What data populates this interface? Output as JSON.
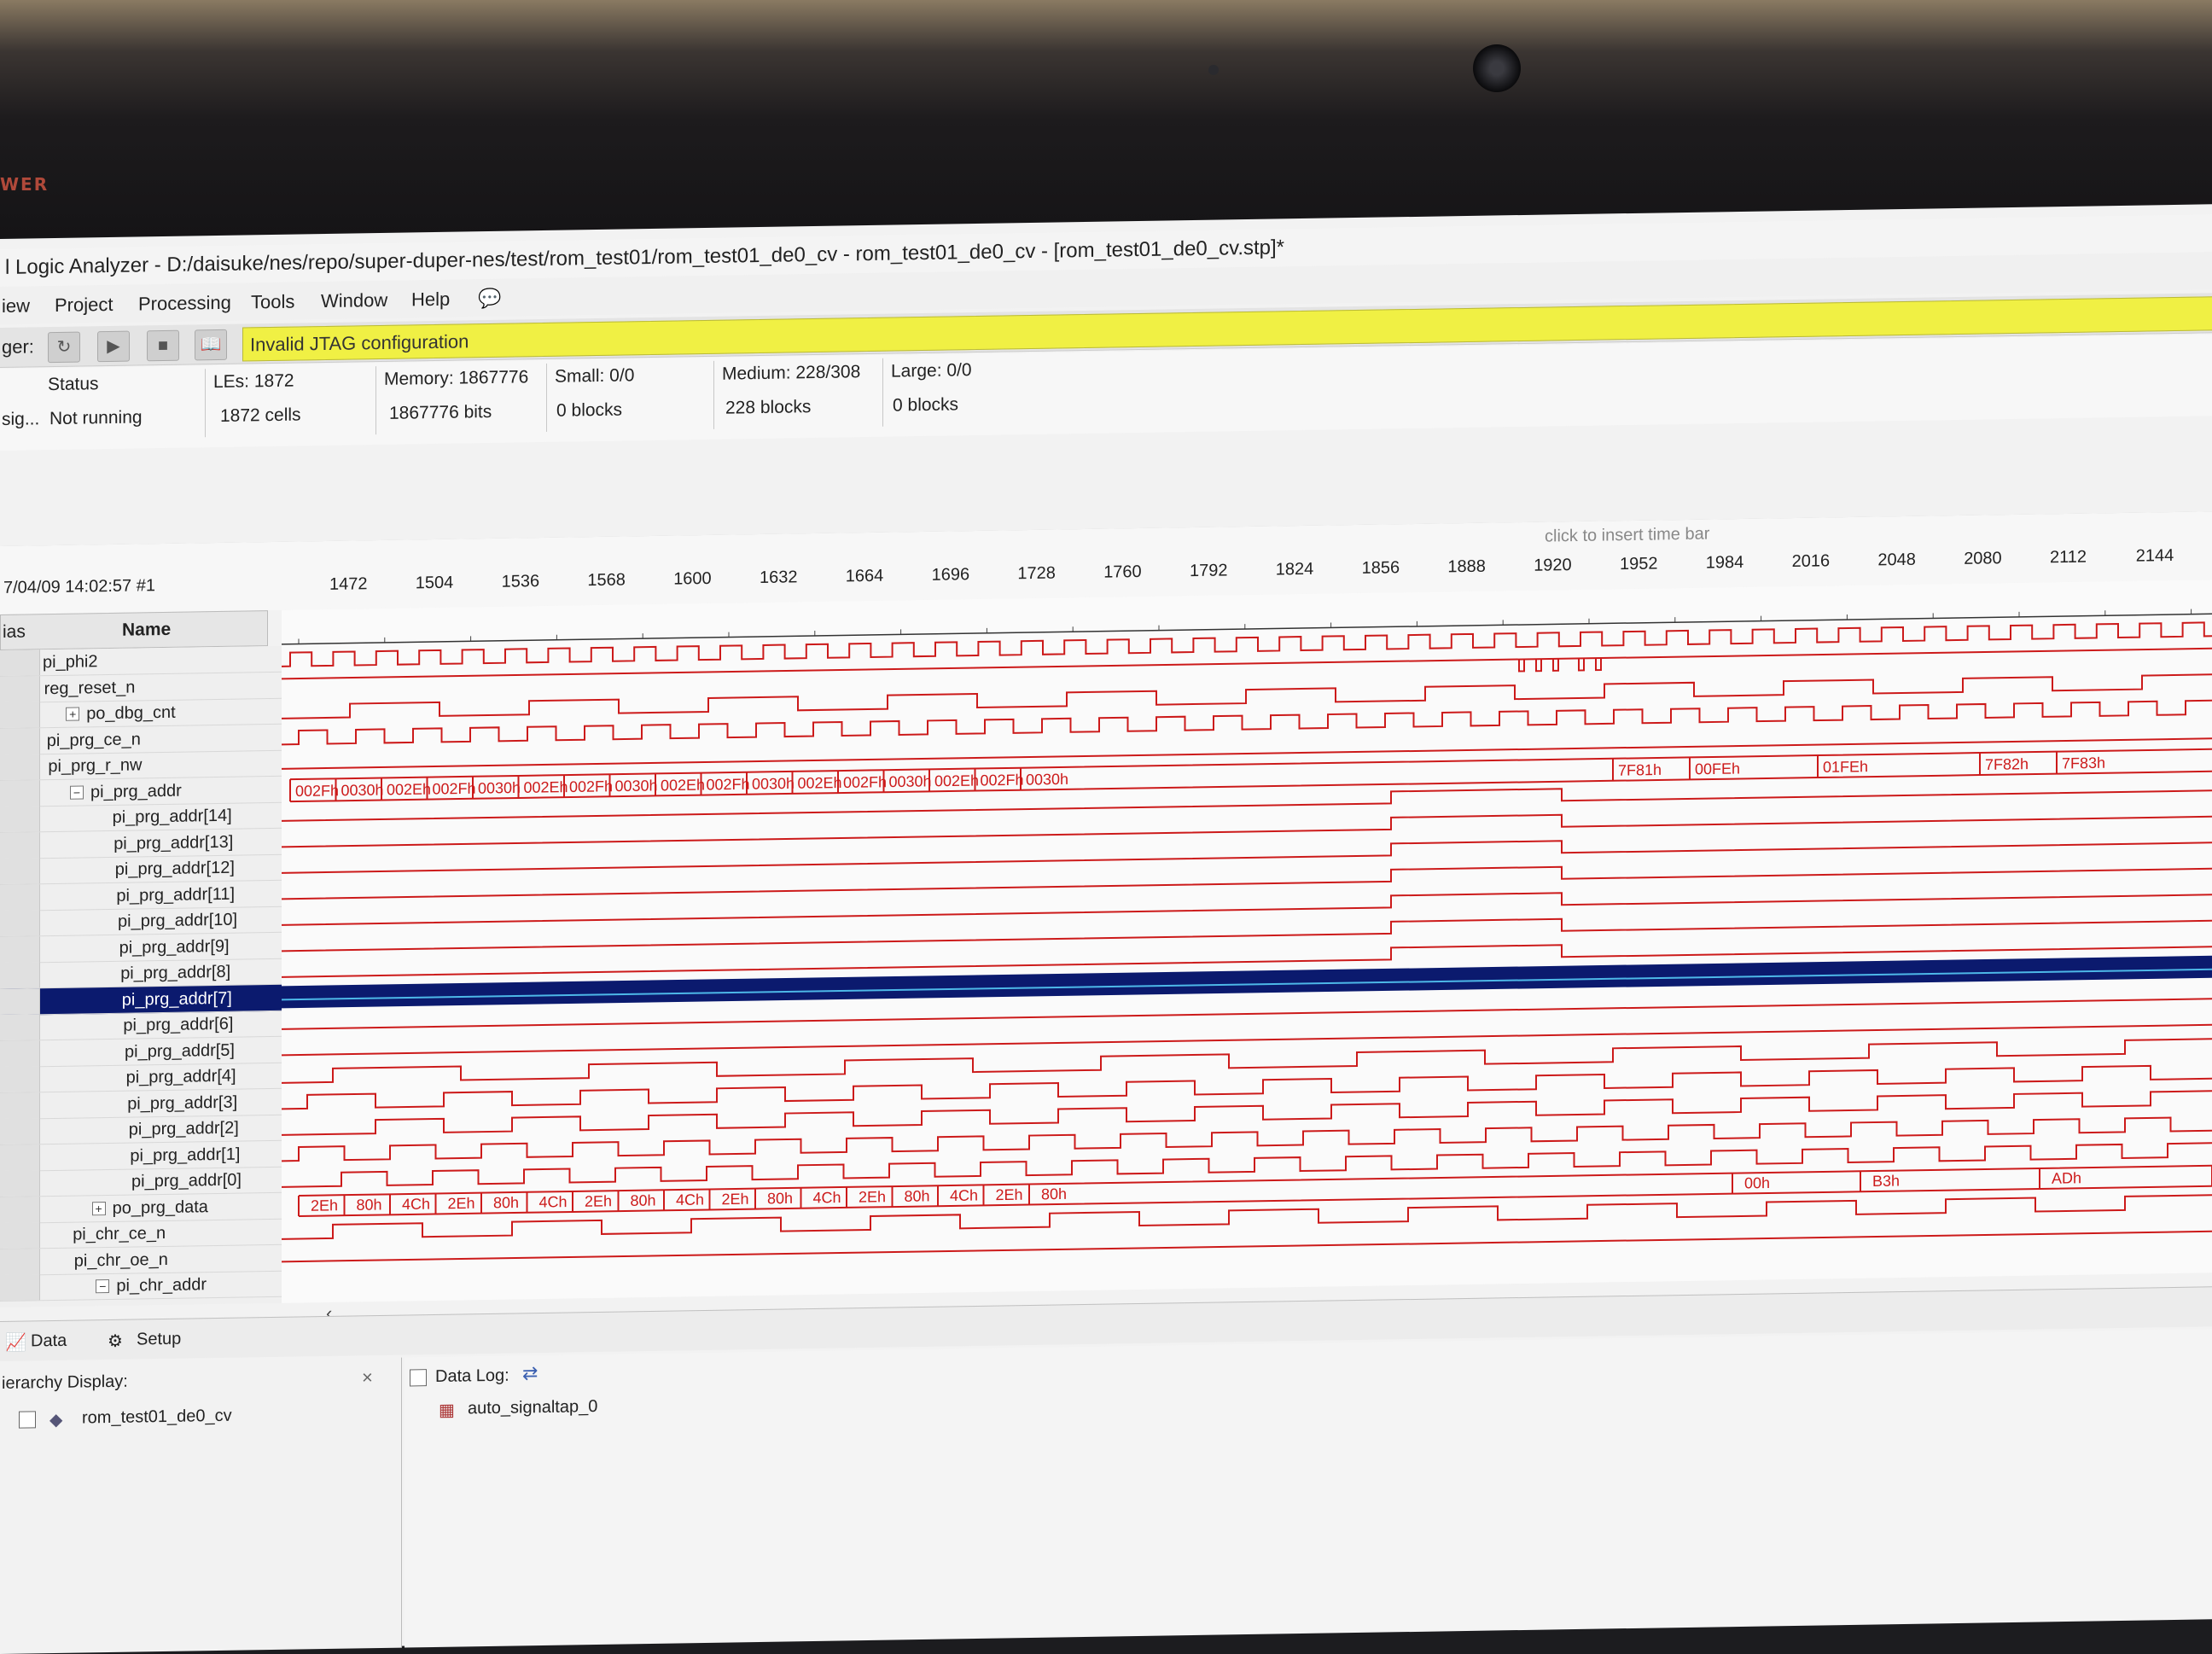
{
  "device_bezel": {
    "power_label": "WER"
  },
  "app": {
    "title": "l Logic Analyzer - D:/daisuke/nes/repo/super-duper-nes/test/rom_test01/rom_test01_de0_cv - rom_test01_de0_cv - [rom_test01_de0_cv.stp]*"
  },
  "menu": {
    "items": [
      "iew",
      "Project",
      "Processing",
      "Tools",
      "Window",
      "Help"
    ]
  },
  "toolbar": {
    "prefix_label": "ger:",
    "status_message": "Invalid JTAG configuration",
    "status_color": "#f0f044"
  },
  "status_table": {
    "headers": [
      "Status",
      "LEs: 1872",
      "Memory: 1867776",
      "Small: 0/0",
      "Medium: 228/308",
      "Large: 0/0"
    ],
    "row_label": "sig...",
    "values": [
      "Not running",
      "1872 cells",
      "1867776 bits",
      "0 blocks",
      "228 blocks",
      "0 blocks"
    ]
  },
  "timebar": {
    "insert_hint": "click to insert time bar",
    "timestamp": "7/04/09 14:02:57  #1",
    "ticks": [
      "1472",
      "1504",
      "1536",
      "1568",
      "1600",
      "1632",
      "1664",
      "1696",
      "1728",
      "1760",
      "1792",
      "1824",
      "1856",
      "1888",
      "1920",
      "1952",
      "1984",
      "2016",
      "2048",
      "2080",
      "2112",
      "2144",
      "2"
    ]
  },
  "signal_list": {
    "alias_header": "ias",
    "name_header": "Name",
    "signals": [
      {
        "name": "pi_phi2",
        "indent": 0,
        "expander": ""
      },
      {
        "name": "reg_reset_n",
        "indent": 0,
        "expander": ""
      },
      {
        "name": "po_dbg_cnt",
        "indent": 1,
        "expander": "+"
      },
      {
        "name": "pi_prg_ce_n",
        "indent": 0,
        "expander": ""
      },
      {
        "name": "pi_prg_r_nw",
        "indent": 0,
        "expander": ""
      },
      {
        "name": "pi_prg_addr",
        "indent": 1,
        "expander": "−"
      },
      {
        "name": "pi_prg_addr[14]",
        "indent": 2,
        "expander": ""
      },
      {
        "name": "pi_prg_addr[13]",
        "indent": 2,
        "expander": ""
      },
      {
        "name": "pi_prg_addr[12]",
        "indent": 2,
        "expander": ""
      },
      {
        "name": "pi_prg_addr[11]",
        "indent": 2,
        "expander": ""
      },
      {
        "name": "pi_prg_addr[10]",
        "indent": 2,
        "expander": ""
      },
      {
        "name": "pi_prg_addr[9]",
        "indent": 2,
        "expander": ""
      },
      {
        "name": "pi_prg_addr[8]",
        "indent": 2,
        "expander": ""
      },
      {
        "name": "pi_prg_addr[7]",
        "indent": 2,
        "expander": "",
        "selected": true
      },
      {
        "name": "pi_prg_addr[6]",
        "indent": 2,
        "expander": ""
      },
      {
        "name": "pi_prg_addr[5]",
        "indent": 2,
        "expander": ""
      },
      {
        "name": "pi_prg_addr[4]",
        "indent": 2,
        "expander": ""
      },
      {
        "name": "pi_prg_addr[3]",
        "indent": 2,
        "expander": ""
      },
      {
        "name": "pi_prg_addr[2]",
        "indent": 2,
        "expander": ""
      },
      {
        "name": "pi_prg_addr[1]",
        "indent": 2,
        "expander": ""
      },
      {
        "name": "pi_prg_addr[0]",
        "indent": 2,
        "expander": ""
      },
      {
        "name": "po_prg_data",
        "indent": 1,
        "expander": "+"
      },
      {
        "name": "pi_chr_ce_n",
        "indent": 0,
        "expander": ""
      },
      {
        "name": "pi_chr_oe_n",
        "indent": 0,
        "expander": ""
      },
      {
        "name": "pi_chr_addr",
        "indent": 1,
        "expander": "−"
      }
    ]
  },
  "waveforms": {
    "trace_color": "#cc1a1a",
    "selected_color": "#0b1a6e",
    "addr_bus_values": [
      "002Fh",
      "0030h",
      "002Eh",
      "002Fh",
      "0030h",
      "002Eh",
      "002Fh",
      "0030h",
      "002Eh",
      "002Fh",
      "0030h",
      "002Eh",
      "002Fh",
      "0030h",
      "002Eh",
      "002Fh",
      "0030h",
      "7F81h",
      "00FEh",
      "01FEh",
      "7F82h",
      "7F83h"
    ],
    "data_bus_values": [
      "2Eh",
      "80h",
      "4Ch",
      "2Eh",
      "80h",
      "4Ch",
      "2Eh",
      "80h",
      "4Ch",
      "2Eh",
      "80h",
      "4Ch",
      "2Eh",
      "80h",
      "4Ch",
      "2Eh",
      "80h",
      "00h",
      "B3h",
      "ADh",
      "00h"
    ]
  },
  "bottom": {
    "tabs": [
      "Data",
      "Setup"
    ],
    "hierarchy_label": "ierarchy Display:",
    "hierarchy_close": "×",
    "hierarchy_item": "rom_test01_de0_cv",
    "datalog_label": "Data Log:",
    "datalog_item": "auto_signaltap_0"
  }
}
